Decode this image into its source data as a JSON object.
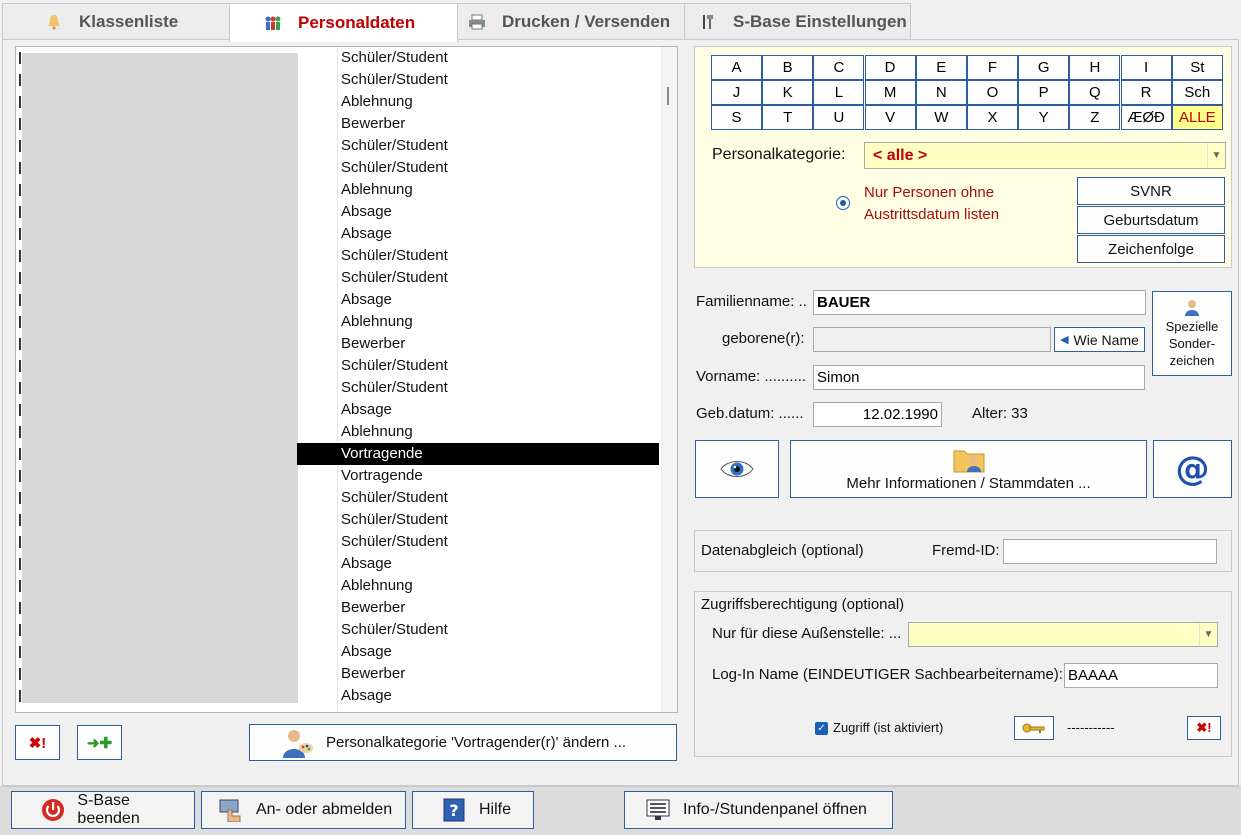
{
  "tabs": [
    {
      "label": "Klassenliste",
      "icon": "bell-icon",
      "active": false
    },
    {
      "label": "Personaldaten",
      "icon": "people-icon",
      "active": true
    },
    {
      "label": "Drucken / Versenden",
      "icon": "printer-icon",
      "active": false
    },
    {
      "label": "S-Base Einstellungen",
      "icon": "tools-icon",
      "active": false
    }
  ],
  "list": {
    "rows": [
      "Schüler/Student",
      "Schüler/Student",
      "Ablehnung",
      "Bewerber",
      "Schüler/Student",
      "Schüler/Student",
      "Ablehnung",
      "Absage",
      "Absage",
      "Schüler/Student",
      "Schüler/Student",
      "Absage",
      "Ablehnung",
      "Bewerber",
      "Schüler/Student",
      "Schüler/Student",
      "Absage",
      "Ablehnung",
      "Vortragende",
      "Vortragende",
      "Schüler/Student",
      "Schüler/Student",
      "Schüler/Student",
      "Absage",
      "Ablehnung",
      "Bewerber",
      "Schüler/Student",
      "Absage",
      "Bewerber",
      "Absage"
    ],
    "selected_index": 18
  },
  "list_buttons": {
    "delete_label": "✖!",
    "add_label": "➜✚",
    "category_change_label": "Personalkategorie 'Vortragender(r)' ändern ..."
  },
  "alphabet": [
    [
      "A",
      "B",
      "C",
      "D",
      "E",
      "F",
      "G",
      "H",
      "I",
      "St"
    ],
    [
      "J",
      "K",
      "L",
      "M",
      "N",
      "O",
      "P",
      "Q",
      "R",
      "Sch"
    ],
    [
      "S",
      "T",
      "U",
      "V",
      "W",
      "X",
      "Y",
      "Z",
      "ÆØÐ",
      "ALLE"
    ]
  ],
  "filter": {
    "kategorie_label": "Personalkategorie:",
    "kategorie_value": "< alle >",
    "radio_text_line1": "Nur Personen ohne",
    "radio_text_line2": "Austrittsdatum listen",
    "sort_buttons": [
      "SVNR",
      "Geburtsdatum",
      "Zeichenfolge"
    ]
  },
  "person": {
    "familienname_label": "Familienname: ..",
    "familienname": "BAUER",
    "geborene_label": "geborene(r):",
    "geborene": "",
    "wie_name_label": "Wie Name",
    "vorname_label": "Vorname: ..........",
    "vorname": "Simon",
    "gebdatum_label": "Geb.datum: ......",
    "gebdatum": "12.02.1990",
    "alter_label": "Alter: 33",
    "sonder_line1": "Spezielle",
    "sonder_line2": "Sonder-",
    "sonder_line3": "zeichen",
    "mehr_info_label": "Mehr Informationen / Stammdaten ..."
  },
  "datenabgleich": {
    "label": "Datenabgleich (optional)",
    "fremd_label": "Fremd-ID:",
    "fremd_value": ""
  },
  "zugriff": {
    "title": "Zugriffsberechtigung (optional)",
    "aussenstelle_label": "Nur für diese Außenstelle: ...",
    "aussenstelle_value": "",
    "login_label": "Log-In Name (EINDEUTIGER Sachbearbeitername):",
    "login_value": "BAAAA",
    "checkbox_label": "Zugriff (ist aktiviert)",
    "password_mask": "-----------",
    "delete_label": "✖!"
  },
  "bottom": {
    "beenden": "S-Base beenden",
    "anmelden": "An- oder abmelden",
    "hilfe": "Hilfe",
    "info": "Info-/Stundenpanel öffnen"
  }
}
